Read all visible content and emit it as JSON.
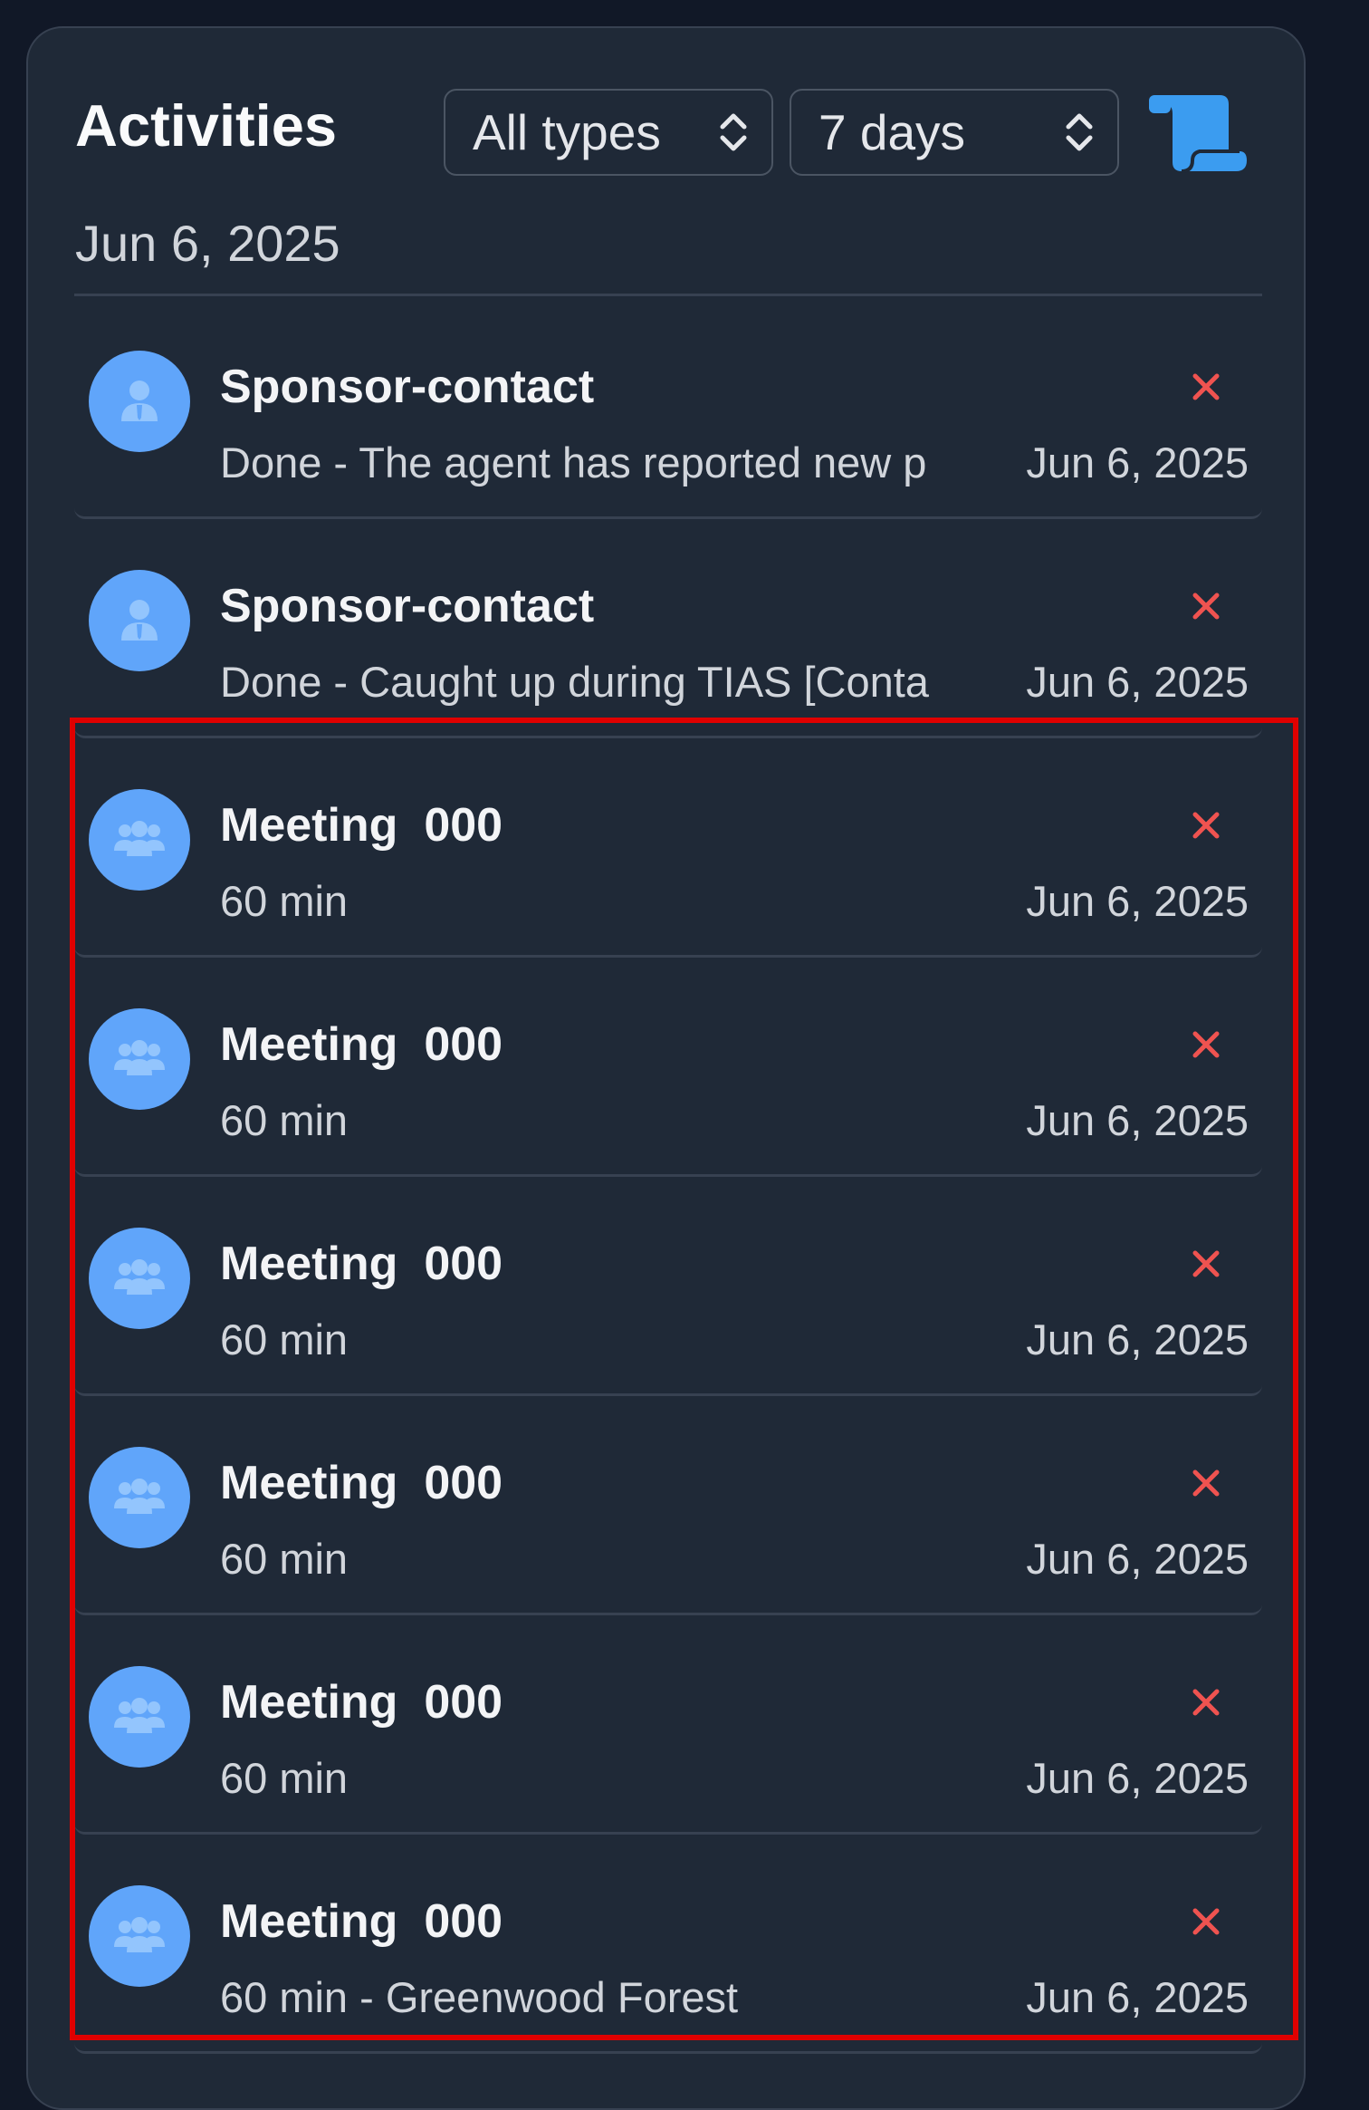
{
  "panel": {
    "title": "Activities",
    "type_filter": {
      "value": "All types"
    },
    "range_filter": {
      "value": "7 days"
    },
    "date_heading": "Jun 6, 2025"
  },
  "colors": {
    "background": "#111827",
    "panel": "#1f2937",
    "accent": "#60a5fa",
    "delete": "#ef5350",
    "highlight": "#e00000"
  },
  "icons": {
    "type_filter": "chevron-up-down-icon",
    "range_filter": "chevron-up-down-icon",
    "history": "scroll-icon",
    "contact": "person-icon",
    "meeting": "group-icon",
    "remove": "close-icon"
  },
  "activities": [
    {
      "title": "Sponsor-contact",
      "subtitle": "Done - The agent has reported new p",
      "date": "Jun 6, 2025",
      "kind": "contact"
    },
    {
      "title": "Sponsor-contact",
      "subtitle": "Done - Caught up during TIAS [Conta",
      "date": "Jun 6, 2025",
      "kind": "contact"
    },
    {
      "title": "Meeting  000",
      "subtitle": "60 min",
      "date": "Jun 6, 2025",
      "kind": "meeting"
    },
    {
      "title": "Meeting  000",
      "subtitle": "60 min",
      "date": "Jun 6, 2025",
      "kind": "meeting"
    },
    {
      "title": "Meeting  000",
      "subtitle": "60 min",
      "date": "Jun 6, 2025",
      "kind": "meeting"
    },
    {
      "title": "Meeting  000",
      "subtitle": "60 min",
      "date": "Jun 6, 2025",
      "kind": "meeting"
    },
    {
      "title": "Meeting  000",
      "subtitle": "60 min",
      "date": "Jun 6, 2025",
      "kind": "meeting"
    },
    {
      "title": "Meeting  000",
      "subtitle": "60 min - Greenwood Forest",
      "date": "Jun 6, 2025",
      "kind": "meeting"
    }
  ]
}
